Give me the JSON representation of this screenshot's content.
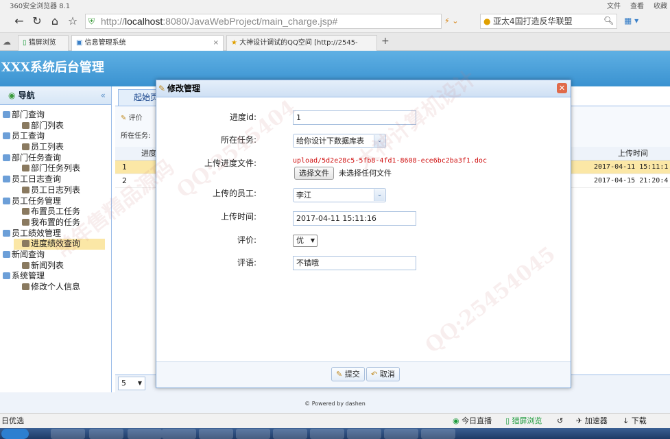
{
  "browser": {
    "name": "360安全浏览器 8.1",
    "menus": [
      "文件",
      "查看",
      "收藏"
    ],
    "url_scheme": "http://",
    "url_host": "localhost",
    "url_rest": ":8080/JavaWebProject/main_charge.jsp#",
    "search_text": "亚太4国打造反华联盟",
    "tabs": [
      {
        "label": "猎屏浏览"
      },
      {
        "label": "信息管理系统"
      },
      {
        "label": "大神设计调试的QQ空间 [http://2545-"
      }
    ]
  },
  "app": {
    "title": "XXX系统后台管理",
    "footer": "© Powered by dashen"
  },
  "sidebar": {
    "header": "导航",
    "collapse": "«",
    "nodes": [
      {
        "label": "部门查询",
        "level": 0
      },
      {
        "label": "部门列表",
        "level": 1
      },
      {
        "label": "员工查询",
        "level": 0
      },
      {
        "label": "员工列表",
        "level": 1
      },
      {
        "label": "部门任务查询",
        "level": 0
      },
      {
        "label": "部门任务列表",
        "level": 1
      },
      {
        "label": "员工日志查询",
        "level": 0
      },
      {
        "label": "员工日志列表",
        "level": 1
      },
      {
        "label": "员工任务管理",
        "level": 0
      },
      {
        "label": "布置员工任务",
        "level": 1
      },
      {
        "label": "我布置的任务",
        "level": 1
      },
      {
        "label": "员工绩效管理",
        "level": 0
      },
      {
        "label": "进度绩效查询",
        "level": 1,
        "selected": true
      },
      {
        "label": "新闻查询",
        "level": 0
      },
      {
        "label": "新闻列表",
        "level": 1
      },
      {
        "label": "系统管理",
        "level": 0
      },
      {
        "label": "修改个人信息",
        "level": 1
      }
    ]
  },
  "content": {
    "tab": "起始页",
    "toolbar_eval": "评价",
    "task_filter_label": "所在任务:",
    "col_progress": "进度",
    "col_time": "上传时间",
    "rows": [
      {
        "no": "1",
        "time": "2017-04-11 15:11:1"
      },
      {
        "no": "2",
        "time": "2017-04-15 21:20:4"
      }
    ],
    "page_size": "5"
  },
  "dialog": {
    "title": "修改管理",
    "close": "✕",
    "fields": {
      "id_label": "进度id:",
      "id_value": "1",
      "task_label": "所在任务:",
      "task_value": "给你设计下数据库表",
      "file_label": "上传进度文件:",
      "file_link": "upload/5d2e28c5-5fb8-4fd1-8608-ece6bc2ba3f1.doc",
      "file_button": "选择文件",
      "file_none": "未选择任何文件",
      "employee_label": "上传的员工:",
      "employee_value": "李江",
      "time_label": "上传时间:",
      "time_value": "2017-04-11 15:11:16",
      "rating_label": "评价:",
      "rating_value": "优",
      "comment_label": "评语:",
      "comment_value": "不错哦"
    },
    "submit": "提交",
    "cancel": "取消"
  },
  "statusbar": {
    "left": "日优选",
    "live": "今日直播",
    "screen": "猎屏浏览",
    "accel": "加速器",
    "download": "下载"
  },
  "watermarks": [
    "QQ:2545404",
    "大神计算机设计",
    "常年售精品源码",
    "QQ:25454045"
  ]
}
